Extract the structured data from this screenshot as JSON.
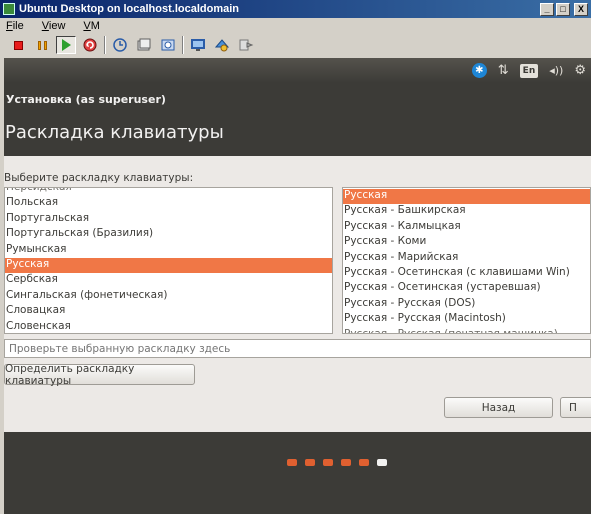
{
  "host": {
    "window_title": "Ubuntu Desktop on localhost.localdomain",
    "window_buttons": [
      "_",
      "□",
      "X"
    ],
    "menu": [
      {
        "pre": "",
        "u": "F",
        "post": "ile"
      },
      {
        "pre": "",
        "u": "V",
        "post": "iew"
      },
      {
        "pre": "",
        "u": "V",
        "post": "M"
      }
    ],
    "toolbar": [
      "stop-icon",
      "pause-icon",
      "play-icon",
      "reset-icon",
      "snapshot-icon",
      "revert-snapshot-icon",
      "snapshot-manager-icon",
      "fullscreen-icon",
      "quick-switch-icon",
      "summary-view-icon"
    ]
  },
  "panel": {
    "accessibility_glyph": "✱",
    "network_glyph": "⇅",
    "language": "En",
    "volume_glyph": "◂))",
    "settings_glyph": "⚙"
  },
  "header": {
    "window_title": "Установка (as superuser)",
    "page_title": "Раскладка клавиатуры"
  },
  "prompt": "Выберите раскладку клавиатуры:",
  "layouts_left": [
    {
      "label": "Персидская",
      "partial": true
    },
    {
      "label": "Польская"
    },
    {
      "label": "Португальская"
    },
    {
      "label": "Португальская (Бразилия)"
    },
    {
      "label": "Румынская"
    },
    {
      "label": "Русская",
      "selected": true
    },
    {
      "label": "Сербская"
    },
    {
      "label": "Сингальская (фонетическая)"
    },
    {
      "label": "Словацкая"
    },
    {
      "label": "Словенская"
    },
    {
      "label": "Сорбская (Лужицкая)",
      "partial": true
    }
  ],
  "layouts_right": [
    {
      "label": "Русская",
      "selected": true
    },
    {
      "label": "Русская - Башкирская"
    },
    {
      "label": "Русская - Калмыцкая"
    },
    {
      "label": "Русская - Коми"
    },
    {
      "label": "Русская - Марийская"
    },
    {
      "label": "Русская - Осетинская (с клавишами Win)"
    },
    {
      "label": "Русская - Осетинская (устаревшая)"
    },
    {
      "label": "Русская - Русская (DOS)"
    },
    {
      "label": "Русская - Русская (Macintosh)"
    },
    {
      "label": "Русская - Русская (печатная машинка)",
      "partial": true
    }
  ],
  "test_field": {
    "placeholder": "Проверьте выбранную раскладку здесь"
  },
  "buttons": {
    "detect": "Определить раскладку клавиатуры",
    "back": "Назад",
    "next": "П"
  },
  "progress": {
    "total_steps": 6,
    "current_step": 6
  },
  "colors": {
    "accent": "#f07746",
    "panel": "#3c3b37"
  }
}
